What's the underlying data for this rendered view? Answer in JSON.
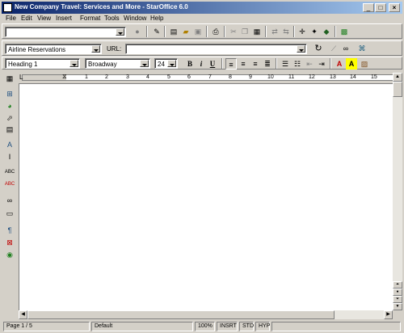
{
  "window": {
    "title": "New Company Travel: Services and More - StarOffice 6.0"
  },
  "menu": [
    "File",
    "Edit",
    "View",
    "Insert",
    "Format",
    "Tools",
    "Window",
    "Help"
  ],
  "function_bar": {
    "load_url": "",
    "url_label": "URL:",
    "url_value": "",
    "hyperlink_name": "Airline Reservations"
  },
  "format_bar": {
    "style": "Heading 1",
    "font": "Broadway",
    "size": "24",
    "bold": "B",
    "italic": "i",
    "underline": "U"
  },
  "ruler": {
    "numbers": [
      "1",
      "2",
      "3",
      "4",
      "5",
      "6",
      "7",
      "8",
      "9",
      "10",
      "11",
      "12",
      "13",
      "14",
      "15"
    ]
  },
  "status": {
    "page": "Page 1 / 5",
    "page_style": "Default",
    "zoom": "100%",
    "insert_mode": "INSRT",
    "selection_mode": "STD",
    "hyperlink_mode": "HYP"
  },
  "colors": {
    "title_start": "#0a246a",
    "title_end": "#a6caf0",
    "document": "#ffffff",
    "chrome": "#d4d0c8"
  }
}
